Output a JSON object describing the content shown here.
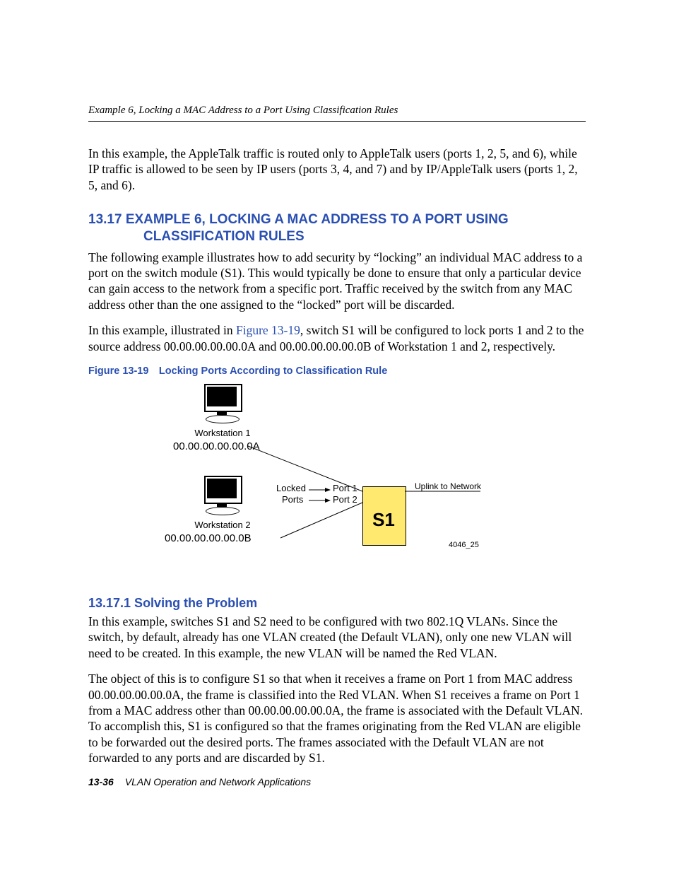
{
  "header": {
    "running": "Example 6, Locking a MAC Address to a Port Using Classification Rules"
  },
  "intro_para": "In this example, the AppleTalk traffic is routed only to AppleTalk users (ports 1, 2, 5, and 6), while IP traffic is allowed to be seen by IP users (ports 3, 4, and 7) and by IP/AppleTalk users (ports 1, 2, 5, and 6).",
  "section": {
    "number_and_title_line1": "13.17 EXAMPLE 6, LOCKING A MAC ADDRESS TO A PORT USING",
    "title_line2": "CLASSIFICATION RULES",
    "para1": "The following example illustrates how to add security by “locking” an individual MAC address to a port on the switch module (S1). This would typically be done to ensure that only a particular device can gain access to the network from a specific port. Traffic received by the switch from any MAC address other than the one assigned to the “locked” port will be discarded.",
    "para2_pre": "In this example, illustrated in ",
    "para2_link": "Figure 13-19",
    "para2_post": ", switch S1 will be configured to lock ports 1 and 2 to the source address 00.00.00.00.00.0A and 00.00.00.00.00.0B of Workstation 1 and 2, respectively."
  },
  "figure": {
    "caption": "Figure 13-19 Locking Ports According to Classification Rule",
    "ws1": "Workstation 1",
    "mac1": "00.00.00.00.00.0A",
    "ws2": "Workstation 2",
    "mac2": "00.00.00.00.00.0B",
    "locked": "Locked",
    "ports": "Ports",
    "port1": "Port 1",
    "port2": "Port 2",
    "switch": "S1",
    "uplink": "Uplink to Network",
    "id": "4046_25"
  },
  "subsection": {
    "heading": "13.17.1 Solving the Problem",
    "para1": "In this example, switches S1 and S2 need to be configured with two 802.1Q VLANs. Since the switch, by default, already has one VLAN created (the Default VLAN), only one new VLAN will need to be created. In this example, the new VLAN will be named the Red VLAN.",
    "para2": "The object of this is to configure S1 so that when it receives a frame on Port 1 from MAC address 00.00.00.00.00.0A, the frame is classified into the Red VLAN. When S1 receives a frame on Port 1 from a MAC address other than 00.00.00.00.00.0A, the frame is associated with the Default VLAN. To accomplish this, S1 is configured so that the frames originating from the Red VLAN are eligible to be forwarded out the desired ports. The frames associated with the Default VLAN are not forwarded to any ports and are discarded by S1."
  },
  "footer": {
    "page": "13-36",
    "chapter": "VLAN Operation and Network Applications"
  }
}
